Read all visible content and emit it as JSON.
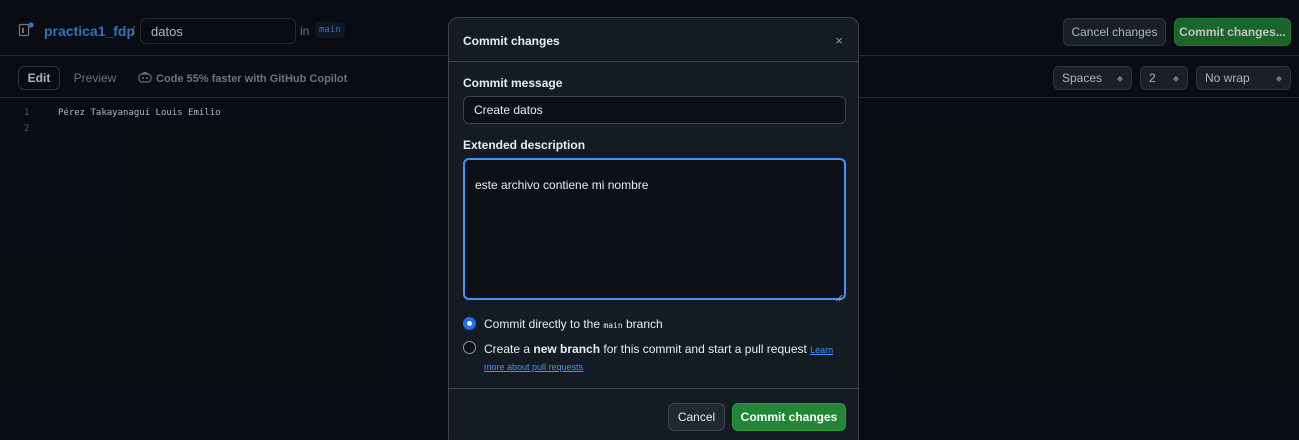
{
  "header": {
    "repo_name": "practica1_fdp",
    "separator": "/",
    "filename_value": "datos",
    "in_label": "in",
    "branch": "main",
    "cancel_label": "Cancel changes",
    "commit_label": "Commit changes..."
  },
  "toolbar": {
    "edit_label": "Edit",
    "preview_label": "Preview",
    "copilot_text": "Code 55% faster with GitHub Copilot",
    "indent_mode": "Spaces",
    "indent_size": "2",
    "wrap_mode": "No wrap"
  },
  "editor": {
    "lines": [
      {
        "number": "1",
        "text": "Pérez Takayanagui Louis Emilio"
      },
      {
        "number": "2",
        "text": ""
      }
    ]
  },
  "dialog": {
    "title": "Commit changes",
    "close_symbol": "×",
    "message_label": "Commit message",
    "message_value": "Create datos",
    "description_label": "Extended description",
    "description_value": "este archivo contiene mi nombre",
    "option_direct_prefix": "Commit directly to the",
    "option_direct_branch": "main",
    "option_direct_suffix": "branch",
    "option_new_prefix": "Create a",
    "option_new_bold": "new branch",
    "option_new_suffix": "for this commit and start a pull request",
    "option_new_link": "Learn more about pull requests",
    "cancel_label": "Cancel",
    "commit_label": "Commit changes"
  },
  "colors": {
    "accent": "#4493f8",
    "primary_button": "#238636",
    "background": "#0d1117",
    "dialog_background": "#151b23"
  },
  "icons": [
    "repo-icon",
    "copilot-icon",
    "close-icon",
    "select-arrow-icon"
  ]
}
